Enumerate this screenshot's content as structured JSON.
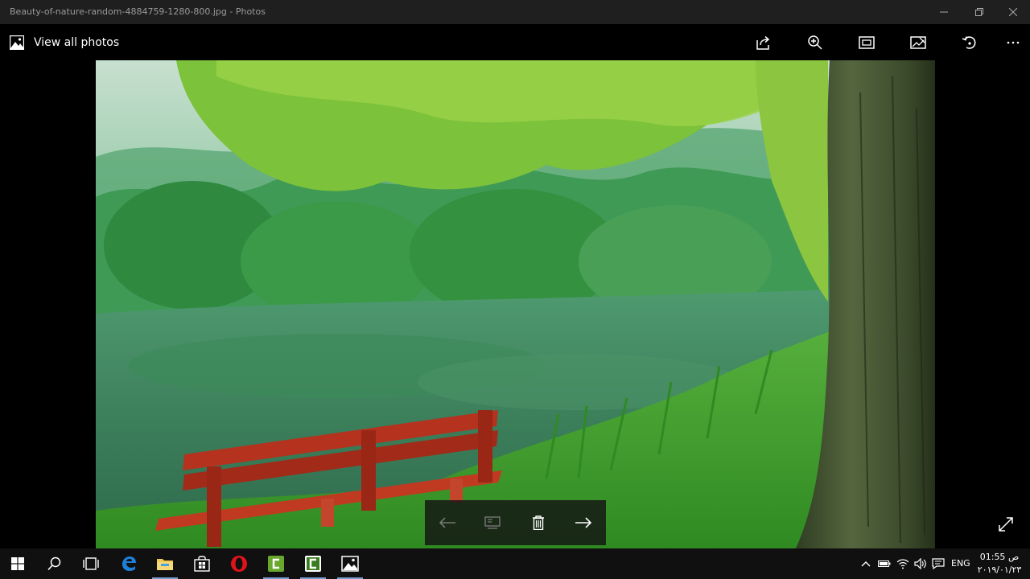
{
  "window": {
    "title": "Beauty-of-nature-random-4884759-1280-800.jpg - Photos",
    "minimize_icon": "minimize-icon",
    "restore_icon": "restore-icon",
    "close_icon": "close-icon"
  },
  "command_bar": {
    "view_all_label": "View all photos",
    "actions": [
      "share",
      "zoom",
      "slideshow",
      "edit-create",
      "rotate",
      "more"
    ]
  },
  "photo": {
    "subject": "misty lake with red bench and tree"
  },
  "film_controls": {
    "buttons": [
      "previous",
      "add-to-album",
      "delete",
      "next"
    ]
  },
  "taskbar": {
    "apps": [
      "start",
      "search",
      "task-view",
      "edge",
      "file-explorer",
      "store",
      "opera",
      "camtasia",
      "camtasia-recorder",
      "photos"
    ],
    "tray": {
      "language": "ENG",
      "time": "01:55 ص",
      "date": "۲۰۱۹/۰۱/۲۳"
    }
  },
  "colors": {
    "titlebar": "#1f1f1f",
    "taskbar": "#101010",
    "bench": "#b5321f",
    "edge_blue": "#1e7fd8",
    "opera_red": "#e0131b",
    "camtasia_green": "#6aa82d"
  }
}
